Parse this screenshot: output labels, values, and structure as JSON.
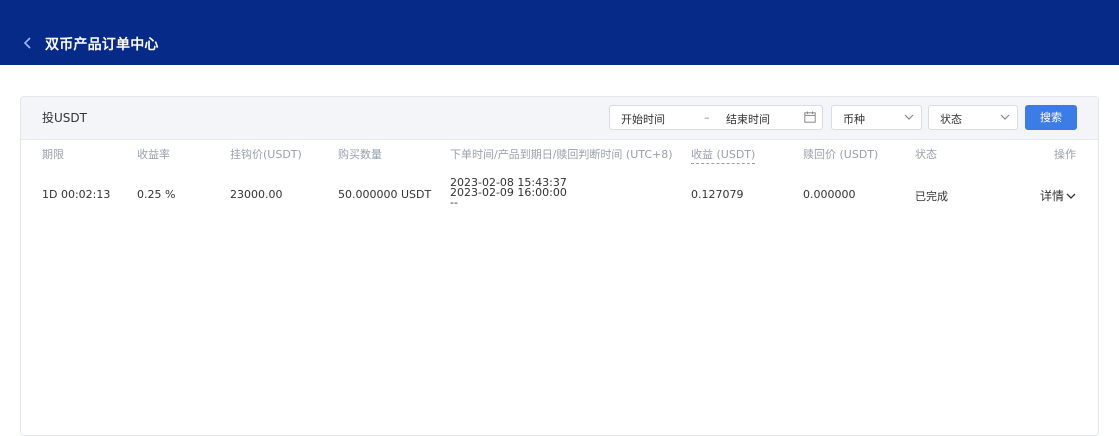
{
  "header": {
    "title": "双币产品订单中心"
  },
  "panel": {
    "label": "投USDT",
    "filters": {
      "start_time_placeholder": "开始时间",
      "separator": "–",
      "end_time_placeholder": "结束时间",
      "currency_label": "币种",
      "status_label": "状态",
      "search_label": "搜索"
    }
  },
  "table": {
    "headers": [
      "期限",
      "收益率",
      "挂钩价(USDT)",
      "购买数量",
      "下单时间/产品到期日/赎回判断时间 (UTC+8)",
      "收益 (USDT)",
      "赎回价 (USDT)",
      "状态",
      "操作"
    ],
    "rows": [
      {
        "term": "1D 00:02:13",
        "yield_rate": "0.25 %",
        "hook_price": "23000.00",
        "amount": "50.000000 USDT",
        "order_time": "2023-02-08 15:43:37",
        "expiry_time": "2023-02-09 16:00:00",
        "judge_time": "--",
        "profit": "0.127079",
        "redeem_price": "0.000000",
        "status": "已完成",
        "action": "详情"
      }
    ]
  },
  "colors": {
    "header_bg": "#062a87",
    "primary_button": "#3b7ce6"
  },
  "icons": {
    "back": "chevron-left-icon",
    "calendar": "calendar-icon",
    "dropdown": "chevron-down-icon"
  }
}
